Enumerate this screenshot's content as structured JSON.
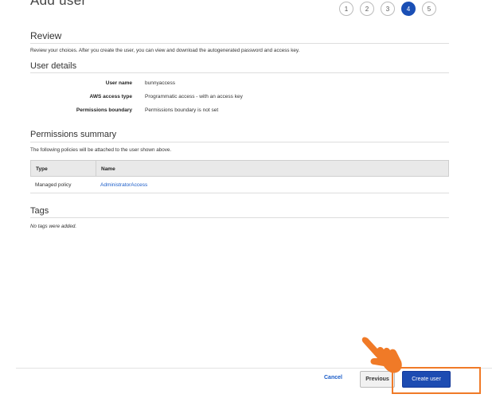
{
  "header": {
    "title": "Add user",
    "steps": [
      "1",
      "2",
      "3",
      "4",
      "5"
    ],
    "active_step": 4
  },
  "review": {
    "title": "Review",
    "description": "Review your choices. After you create the user, you can view and download the autogenerated password and access key."
  },
  "user_details": {
    "title": "User details",
    "rows": [
      {
        "label": "User name",
        "value": "bunnyaccess"
      },
      {
        "label": "AWS access type",
        "value": "Programmatic access - with an access key"
      },
      {
        "label": "Permissions boundary",
        "value": "Permissions boundary is not set"
      }
    ]
  },
  "permissions": {
    "title": "Permissions summary",
    "description": "The following policies will be attached to the user shown above.",
    "columns": [
      "Type",
      "Name"
    ],
    "rows": [
      {
        "type": "Managed policy",
        "name": "AdministratorAccess"
      }
    ]
  },
  "tags": {
    "title": "Tags",
    "empty_text": "No tags were added."
  },
  "footer": {
    "cancel_label": "Cancel",
    "previous_label": "Previous",
    "create_label": "Create user"
  },
  "colors": {
    "accent": "#1d4cb2",
    "link": "#1a5cc8",
    "highlight": "#f07a27"
  },
  "icons": {
    "pointer": "pointing-hand-icon"
  }
}
